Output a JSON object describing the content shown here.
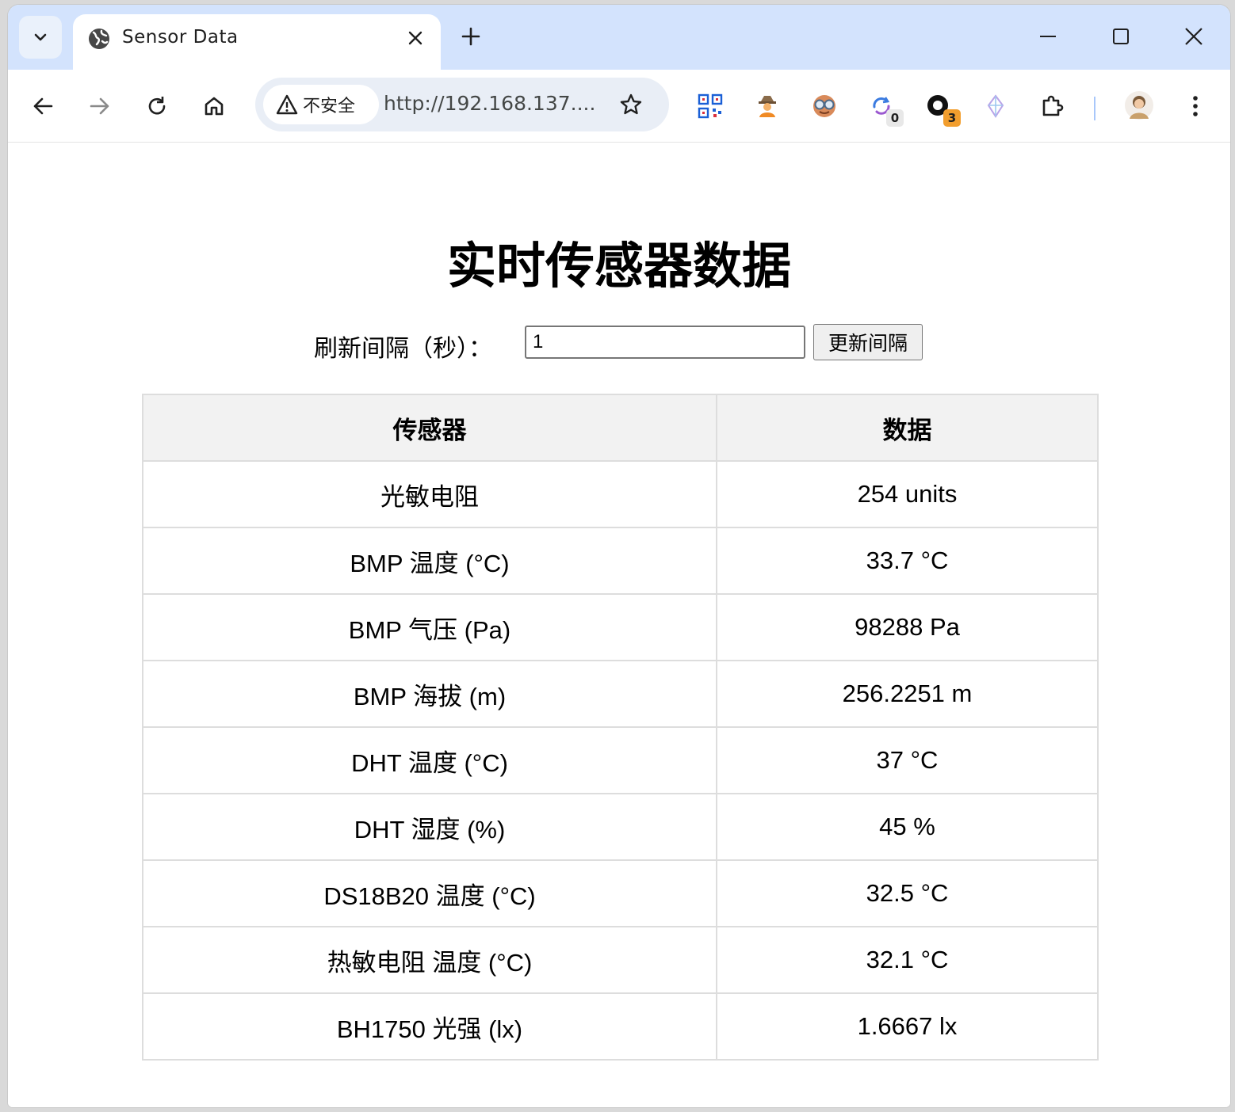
{
  "browser": {
    "tab": {
      "title": "Sensor Data"
    },
    "omnibox": {
      "security_label": "不安全",
      "url": "http://192.168.137...."
    },
    "extensions": [
      {
        "name": "qr-code-icon",
        "badge": ""
      },
      {
        "name": "spy-extension-icon",
        "badge": ""
      },
      {
        "name": "goggles-extension-icon",
        "badge": ""
      },
      {
        "name": "sync-extension-icon",
        "badge": "0"
      },
      {
        "name": "circle-extension-icon",
        "badge": "3"
      },
      {
        "name": "crystal-extension-icon",
        "badge": ""
      }
    ]
  },
  "page": {
    "title": "实时传感器数据",
    "interval": {
      "label": "刷新间隔（秒）：",
      "value": "1",
      "button_label": "更新间隔"
    },
    "table": {
      "headers": [
        "传感器",
        "数据"
      ],
      "rows": [
        {
          "sensor": "光敏电阻",
          "value": "254 units"
        },
        {
          "sensor": "BMP 温度 (°C)",
          "value": "33.7 °C"
        },
        {
          "sensor": "BMP 气压 (Pa)",
          "value": "98288 Pa"
        },
        {
          "sensor": "BMP 海拔 (m)",
          "value": "256.2251 m"
        },
        {
          "sensor": "DHT 温度 (°C)",
          "value": "37 °C"
        },
        {
          "sensor": "DHT 湿度 (%)",
          "value": "45 %"
        },
        {
          "sensor": "DS18B20 温度 (°C)",
          "value": "32.5 °C"
        },
        {
          "sensor": "热敏电阻 温度 (°C)",
          "value": "32.1 °C"
        },
        {
          "sensor": "BH1750 光强 (lx)",
          "value": "1.6667 lx"
        }
      ]
    }
  }
}
